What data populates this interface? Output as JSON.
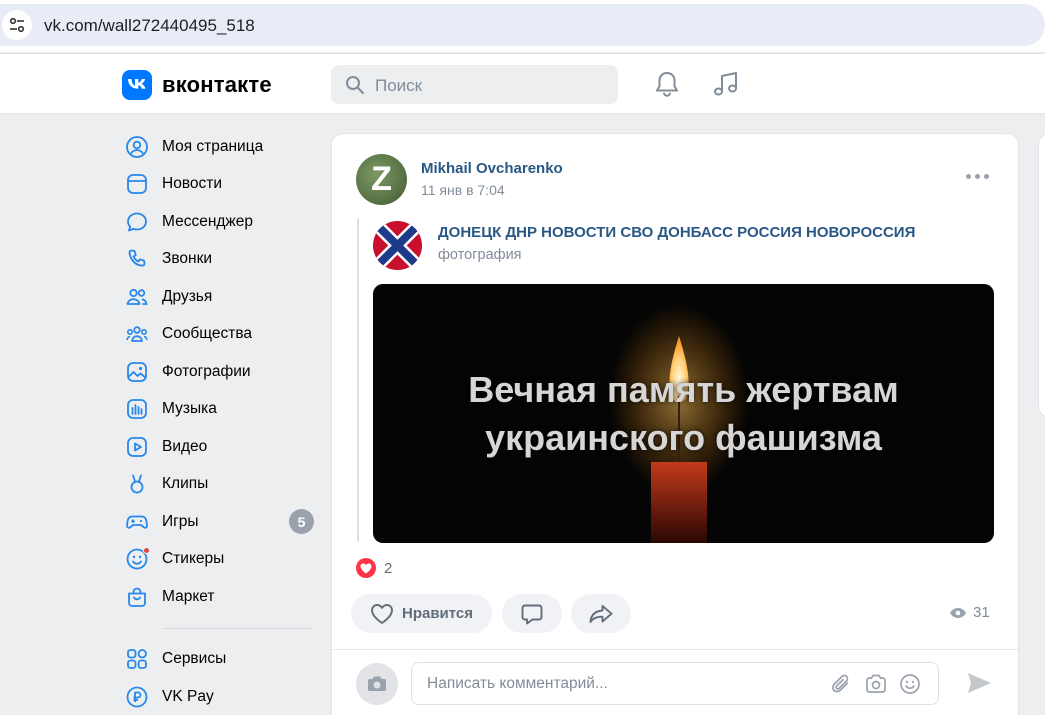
{
  "browser": {
    "url": "vk.com/wall272440495_518"
  },
  "header": {
    "logo_text": "вконтакте",
    "search_placeholder": "Поиск",
    "accent": "#0077ff"
  },
  "sidebar": {
    "items": [
      {
        "label": "Моя страница",
        "icon": "user-icon"
      },
      {
        "label": "Новости",
        "icon": "news-icon"
      },
      {
        "label": "Мессенджер",
        "icon": "message-icon"
      },
      {
        "label": "Звонки",
        "icon": "phone-icon"
      },
      {
        "label": "Друзья",
        "icon": "friends-icon"
      },
      {
        "label": "Сообщества",
        "icon": "communities-icon"
      },
      {
        "label": "Фотографии",
        "icon": "photo-icon"
      },
      {
        "label": "Музыка",
        "icon": "music-icon"
      },
      {
        "label": "Видео",
        "icon": "video-icon"
      },
      {
        "label": "Клипы",
        "icon": "clips-icon"
      },
      {
        "label": "Игры",
        "icon": "games-icon",
        "badge": "5"
      },
      {
        "label": "Стикеры",
        "icon": "stickers-icon"
      },
      {
        "label": "Маркет",
        "icon": "market-icon"
      }
    ],
    "extra_items": [
      {
        "label": "Сервисы",
        "icon": "services-icon"
      },
      {
        "label": "VK Pay",
        "icon": "vkpay-icon"
      }
    ]
  },
  "post": {
    "author": "Mikhail Ovcharenko",
    "avatar_letter": "Z",
    "date": "11 янв в 7:04",
    "repost": {
      "group_name": "ДОНЕЦК ДНР НОВОСТИ СВО ДОНБАСС РОССИЯ НОВОРОССИЯ",
      "subtitle": "фотография",
      "image_text_line1": "Вечная память жертвам",
      "image_text_line2": "украинского фашизма"
    },
    "likes_count": "2",
    "like_label": "Нравится",
    "views_count": "31",
    "comment_placeholder": "Написать комментарий..."
  }
}
